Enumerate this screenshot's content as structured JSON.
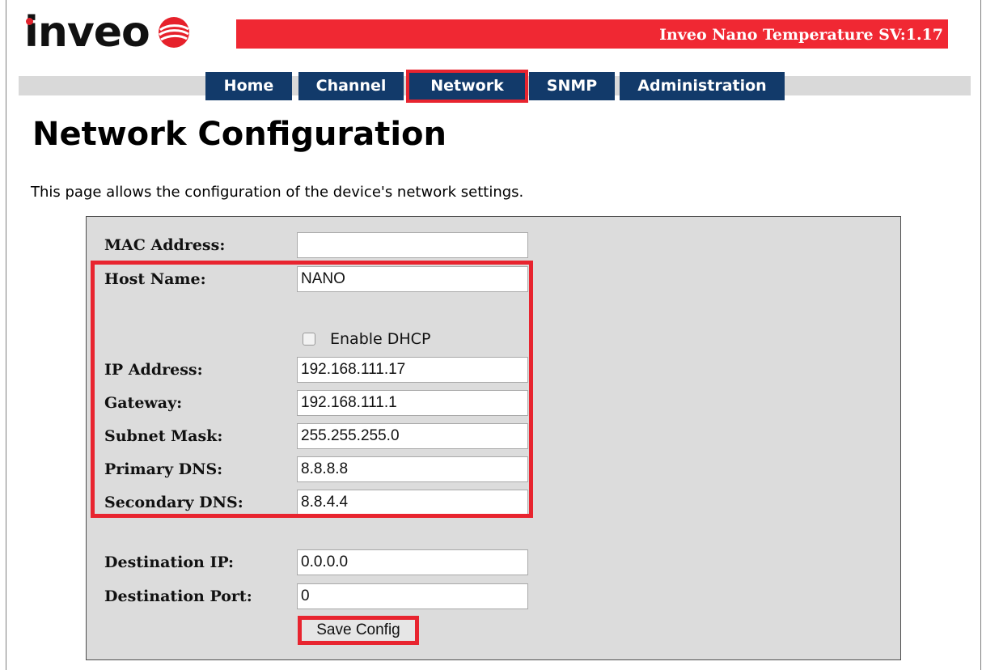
{
  "logo": {
    "text": "inveo"
  },
  "header": {
    "title": "Inveo Nano Temperature SV:1.17"
  },
  "nav": {
    "tabs": [
      {
        "label": "Home"
      },
      {
        "label": "Channel"
      },
      {
        "label": "Network",
        "active": true
      },
      {
        "label": "SNMP"
      },
      {
        "label": "Administration"
      }
    ]
  },
  "page": {
    "title": "Network Configuration",
    "intro": "This page allows the configuration of the device's network settings."
  },
  "form": {
    "mac_address": {
      "label": "MAC Address:",
      "value": ""
    },
    "host_name": {
      "label": "Host Name:",
      "value": "NANO"
    },
    "dhcp": {
      "label": "Enable DHCP",
      "checked": false
    },
    "ip_address": {
      "label": "IP Address:",
      "value": "192.168.111.17"
    },
    "gateway": {
      "label": "Gateway:",
      "value": "192.168.111.1"
    },
    "subnet_mask": {
      "label": "Subnet Mask:",
      "value": "255.255.255.0"
    },
    "primary_dns": {
      "label": "Primary DNS:",
      "value": "8.8.8.8"
    },
    "secondary_dns": {
      "label": "Secondary DNS:",
      "value": "8.8.4.4"
    },
    "destination_ip": {
      "label": "Destination IP:",
      "value": "0.0.0.0"
    },
    "destination_port": {
      "label": "Destination Port:",
      "value": "0"
    },
    "save_label": "Save Config"
  },
  "colors": {
    "brand_red": "#f02833",
    "nav_blue": "#123a6a",
    "highlight_red": "#e8242f",
    "form_background": "#dcdcdc"
  }
}
